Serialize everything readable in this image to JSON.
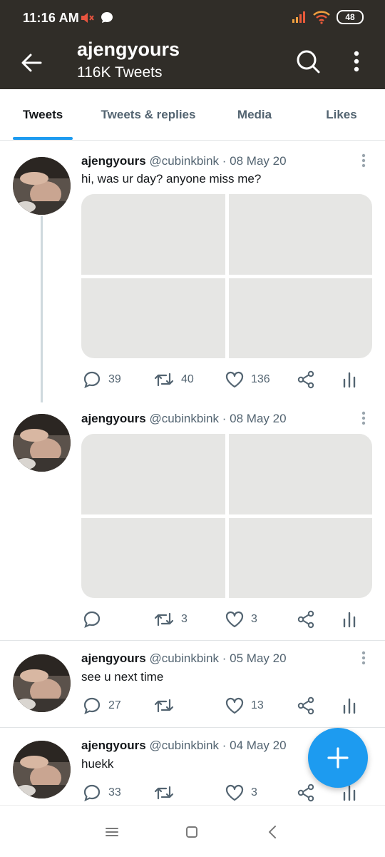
{
  "status_bar": {
    "time": "11:16 AM",
    "battery": "48"
  },
  "header": {
    "name": "ajengyours",
    "tweet_count": "116K Tweets"
  },
  "tabs": [
    {
      "label": "Tweets",
      "active": true
    },
    {
      "label": "Tweets & replies",
      "active": false
    },
    {
      "label": "Media",
      "active": false
    },
    {
      "label": "Likes",
      "active": false
    }
  ],
  "tweets": [
    {
      "name": "ajengyours",
      "handle": "@cubinkbink",
      "date": "· 08 May 20",
      "text": "hi, was ur day? anyone miss me?",
      "replies": "39",
      "retweets": "40",
      "likes": "136"
    },
    {
      "name": "ajengyours",
      "handle": "@cubinkbink",
      "date": "· 08 May 20",
      "text": "",
      "replies": "",
      "retweets": "3",
      "likes": "3"
    },
    {
      "name": "ajengyours",
      "handle": "@cubinkbink",
      "date": "· 05 May 20",
      "text": "see u next time",
      "replies": "27",
      "retweets": "",
      "likes": "13"
    },
    {
      "name": "ajengyours",
      "handle": "@cubinkbink",
      "date": "· 04 May 20",
      "text": "huekk",
      "replies": "33",
      "retweets": "",
      "likes": "3"
    }
  ],
  "colors": {
    "accent": "#1d9bf0",
    "header_bg": "#302d28",
    "muted": "#536471"
  }
}
